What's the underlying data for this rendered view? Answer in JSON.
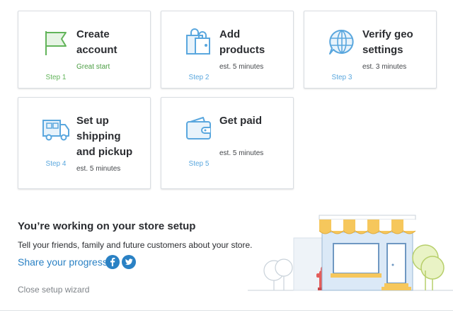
{
  "steps": [
    {
      "title_line1": "Create",
      "title_line2": "account",
      "step": "Step 1",
      "est": "Great start",
      "icon": "flag-icon",
      "done": true
    },
    {
      "title_line1": "Add",
      "title_line2": "products",
      "step": "Step 2",
      "est": "est. 5 minutes",
      "icon": "shopping-bag-icon",
      "done": false
    },
    {
      "title_line1": "Verify geo",
      "title_line2": "settings",
      "step": "Step 3",
      "est": "est. 3 minutes",
      "icon": "globe-chat-icon",
      "done": false
    },
    {
      "title_line1": "Set up",
      "title_line2": "shipping",
      "title_line3": "and pickup",
      "step": "Step 4",
      "est": "est. 5 minutes",
      "icon": "truck-icon",
      "done": false
    },
    {
      "title_line1": "Get paid",
      "step": "Step 5",
      "est": "est. 5 minutes",
      "icon": "wallet-icon",
      "done": false
    }
  ],
  "setup": {
    "heading": "You’re working on your store setup",
    "subtext": "Tell your friends, family and future customers about your store.",
    "share_label": "Share your progress",
    "close_label": "Close setup wizard"
  },
  "social": [
    "facebook-icon",
    "twitter-icon"
  ],
  "colors": {
    "accent_blue": "#2a81c4",
    "icon_blue": "#5aa7de",
    "done_green": "#62b45a",
    "awning_yellow": "#f6c75c"
  }
}
